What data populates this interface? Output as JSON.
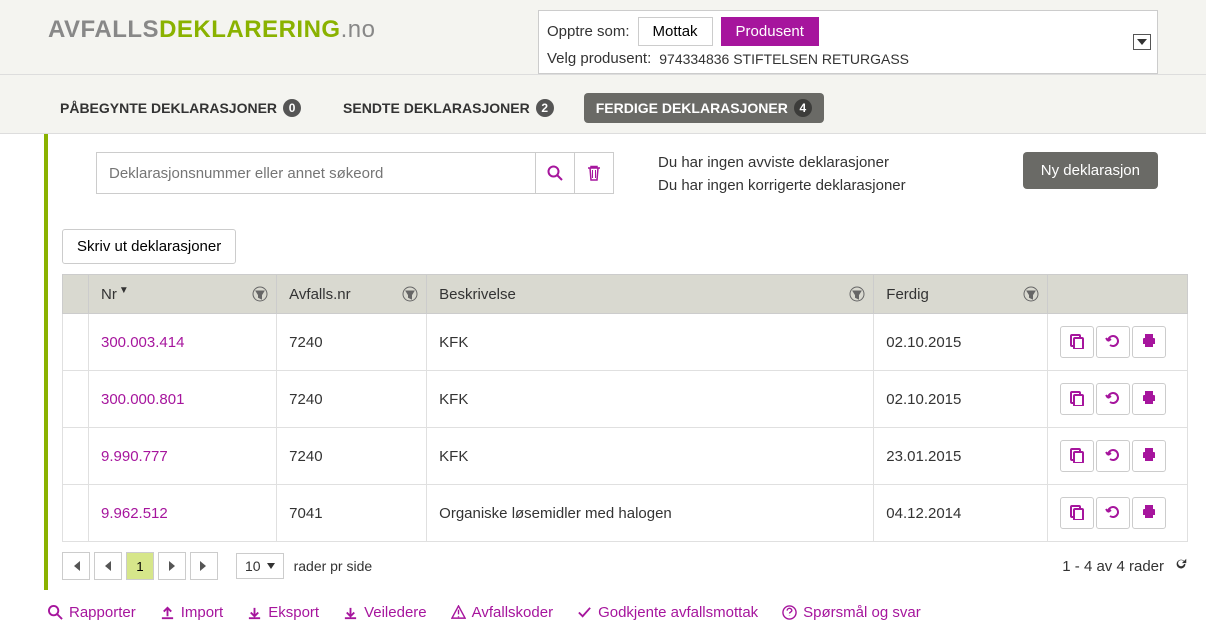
{
  "logo": {
    "part1": "AVFALLS",
    "part2": "DEKLARERING",
    "domain": ".no"
  },
  "role": {
    "label": "Opptre som:",
    "option1": "Mottak",
    "option2": "Produsent",
    "producer_label": "Velg produsent:",
    "producer_value": "974334836 STIFTELSEN RETURGASS"
  },
  "tabs": {
    "t1": {
      "label": "PÅBEGYNTE DEKLARASJONER",
      "count": "0"
    },
    "t2": {
      "label": "SENDTE DEKLARASJONER",
      "count": "2"
    },
    "t3": {
      "label": "FERDIGE DEKLARASJONER",
      "count": "4"
    }
  },
  "search": {
    "placeholder": "Deklarasjonsnummer eller annet søkeord"
  },
  "status": {
    "line1": "Du har ingen avviste deklarasjoner",
    "line2": "Du har ingen korrigerte deklarasjoner"
  },
  "buttons": {
    "new": "Ny deklarasjon",
    "print": "Skriv ut deklarasjoner"
  },
  "columns": {
    "nr": "Nr",
    "avfallsnr": "Avfalls.nr",
    "beskrivelse": "Beskrivelse",
    "ferdig": "Ferdig"
  },
  "rows": [
    {
      "nr": "300.003.414",
      "avfallsnr": "7240",
      "beskrivelse": "KFK",
      "ferdig": "02.10.2015"
    },
    {
      "nr": "300.000.801",
      "avfallsnr": "7240",
      "beskrivelse": "KFK",
      "ferdig": "02.10.2015"
    },
    {
      "nr": "9.990.777",
      "avfallsnr": "7240",
      "beskrivelse": "KFK",
      "ferdig": "23.01.2015"
    },
    {
      "nr": "9.962.512",
      "avfallsnr": "7041",
      "beskrivelse": "Organiske løsemidler med halogen",
      "ferdig": "04.12.2014"
    }
  ],
  "pager": {
    "current": "1",
    "page_size": "10",
    "per_page_label": "rader pr side",
    "info": "1 - 4 av 4 rader"
  },
  "footer": {
    "rapporter": "Rapporter",
    "import": "Import",
    "eksport": "Eksport",
    "veiledere": "Veiledere",
    "avfallskoder": "Avfallskoder",
    "mottak": "Godkjente avfallsmottak",
    "faq": "Spørsmål og svar"
  }
}
